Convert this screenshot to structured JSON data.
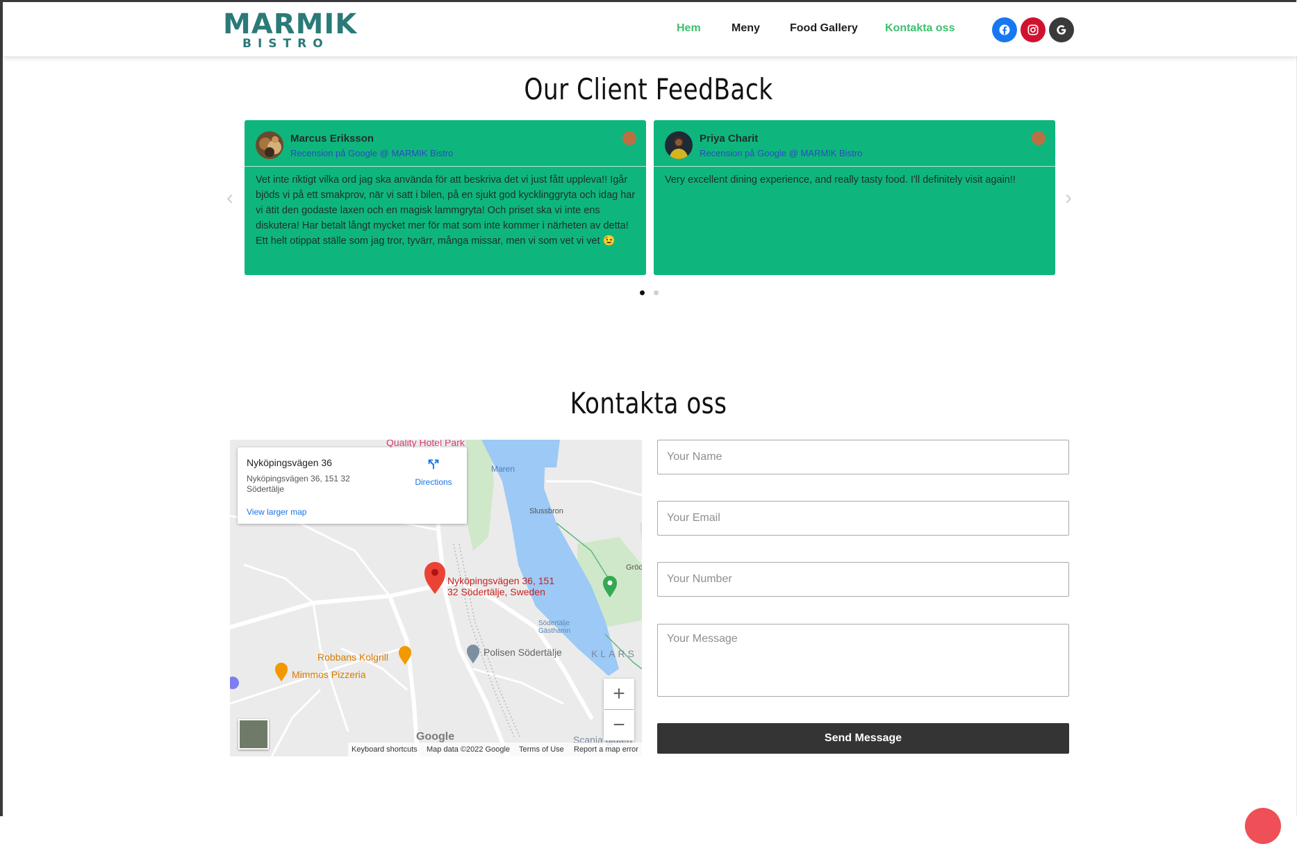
{
  "brand": {
    "name": "MARMIK",
    "subname": "BISTRO"
  },
  "nav": [
    {
      "label": "Hem",
      "active": true
    },
    {
      "label": "Meny",
      "active": false
    },
    {
      "label": "Food Gallery",
      "active": false
    },
    {
      "label": "Kontakta oss",
      "active": true
    }
  ],
  "social": [
    {
      "name": "facebook-icon",
      "color": "#1877f2"
    },
    {
      "name": "instagram-icon",
      "color": "#d1122f"
    },
    {
      "name": "google-icon",
      "color": "#3a3a3a"
    }
  ],
  "feedback": {
    "title": "Our Client FeedBack",
    "prev_arrow": "‹",
    "next_arrow": "›",
    "reviews": [
      {
        "name": "Marcus Eriksson",
        "source": "Recension på Google @ MARMIK Bistro",
        "text": "Vet inte riktigt vilka ord jag ska använda för att beskriva det vi just fått uppleva!! Igår bjöds vi på ett smakprov, när vi satt i bilen, på en sjukt god kycklinggryta och idag har vi ätit den godaste laxen och en magisk lammgryta! Och priset ska vi inte ens diskutera! Har betalt långt mycket mer för mat som inte kommer i närheten av detta! Ett helt otippat ställe som jag tror, tyvärr, många missar, men vi som vet vi vet 😉"
      },
      {
        "name": "Priya Charit",
        "source": "Recension på Google @ MARMIK Bistro",
        "text": "Very excellent dining experience, and really tasty food. I'll definitely visit again!!"
      }
    ],
    "dots": [
      {
        "active": true
      },
      {
        "active": false
      }
    ]
  },
  "contact": {
    "title": "Kontakta oss",
    "map": {
      "place_title": "Nyköpingsvägen 36",
      "place_address": "Nyköpingsvägen 36, 151 32 Södertälje",
      "view_larger": "View larger map",
      "directions": "Directions",
      "pin_label_line1": "Nyköpingsvägen 36, 151",
      "pin_label_line2": "32 Södertälje, Sweden",
      "labels": {
        "hotel": "Quality Hotel Park",
        "maren": "Maren",
        "slussbron": "Slussbron",
        "robbans": "Robbans Kolgrill",
        "mimmos": "Mimmos Pizzeria",
        "polisen": "Polisen Södertälje",
        "gasthamn": "Södertälje Gästhamn",
        "klars": "KLARS",
        "scania": "Scania gjuteri",
        "grod": "Gröd",
        "google": "Google"
      },
      "zoom_in": "+",
      "zoom_out": "−",
      "footer": [
        "Keyboard shortcuts",
        "Map data ©2022 Google",
        "Terms of Use",
        "Report a map error"
      ]
    },
    "form": {
      "name_placeholder": "Your Name",
      "email_placeholder": "Your Email",
      "number_placeholder": "Your Number",
      "message_placeholder": "Your Message",
      "submit_label": "Send Message"
    }
  }
}
